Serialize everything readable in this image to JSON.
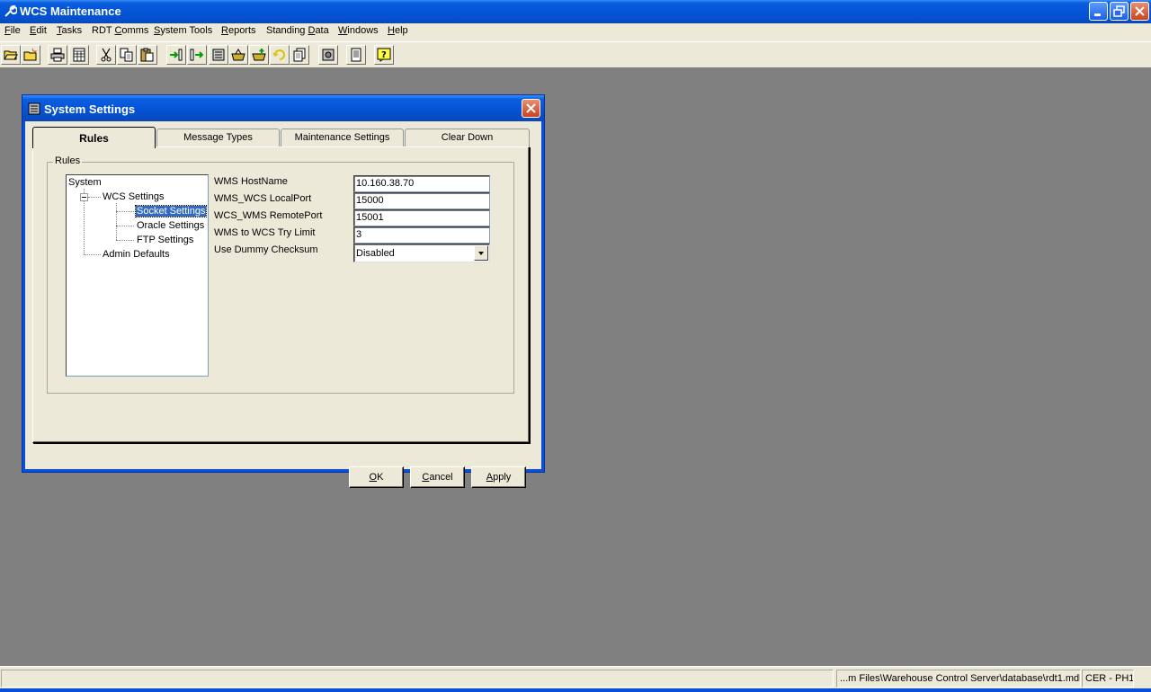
{
  "window": {
    "title": "WCS Maintenance",
    "icon": "wrench-icon"
  },
  "menu": [
    {
      "pre": "",
      "key": "F",
      "post": "ile"
    },
    {
      "pre": "",
      "key": "E",
      "post": "dit"
    },
    {
      "pre": "",
      "key": "T",
      "post": "asks"
    },
    {
      "pre": "RDT ",
      "key": "C",
      "post": "omms"
    },
    {
      "pre": "",
      "key": "S",
      "post": "ystem Tools"
    },
    {
      "pre": "",
      "key": "R",
      "post": "eports"
    },
    {
      "pre": "Standing ",
      "key": "D",
      "post": "ata"
    },
    {
      "pre": "",
      "key": "W",
      "post": "indows"
    },
    {
      "pre": "",
      "key": "H",
      "post": "elp"
    }
  ],
  "toolbar": {
    "icons": [
      "open-folder-icon",
      "new-folder-icon",
      "print-icon",
      "calculator-icon",
      "cut-icon",
      "copy-icon",
      "paste-icon",
      "import-icon",
      "export-icon",
      "server-icon",
      "basket-icon",
      "basket-add-icon",
      "refresh-icon",
      "pages-icon",
      "settings-icon",
      "document-icon",
      "help-icon"
    ]
  },
  "dialog": {
    "title": "System Settings",
    "tabs": [
      "Rules",
      "Message Types",
      "Maintenance Settings",
      "Clear Down"
    ],
    "group_label": "Rules",
    "tree": {
      "root": "System",
      "wcs_settings": "WCS Settings",
      "socket_settings": "Socket Settings",
      "oracle_settings": "Oracle Settings",
      "ftp_settings": "FTP Settings",
      "admin_defaults": "Admin Defaults"
    },
    "fields": {
      "wms_hostname_label": "WMS HostName",
      "wms_hostname_value": "10.160.38.70",
      "local_port_label": "WMS_WCS LocalPort",
      "local_port_value": "15000",
      "remote_port_label": "WCS_WMS RemotePort",
      "remote_port_value": "15001",
      "try_limit_label": "WMS to WCS Try Limit",
      "try_limit_value": "3",
      "dummy_checksum_label": "Use Dummy Checksum",
      "dummy_checksum_value": "Disabled"
    },
    "buttons": {
      "ok": {
        "key": "O",
        "post": "K"
      },
      "cancel": {
        "key": "C",
        "post": "ancel"
      },
      "apply": {
        "key": "A",
        "post": "pply"
      }
    }
  },
  "status": {
    "pane1": "",
    "pane2": "...m Files\\Warehouse Control Server\\database\\rdt1.mdb",
    "pane3": "CER - PH1"
  },
  "colors": {
    "titlebar": "#0554d6",
    "mdi_background": "#808080",
    "selection": "#316ac5"
  }
}
